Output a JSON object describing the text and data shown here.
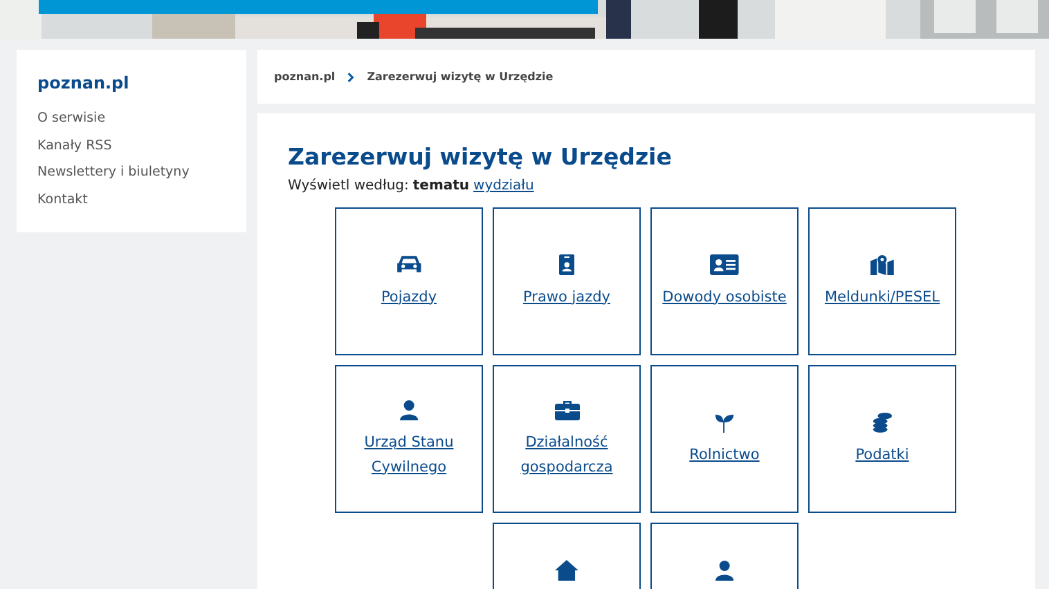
{
  "sidebar": {
    "title": "poznan.pl",
    "items": [
      "O serwisie",
      "Kanały RSS",
      "Newslettery i biuletyny",
      "Kontakt"
    ]
  },
  "breadcrumb": [
    "poznan.pl",
    "Zarezerwuj wizytę w Urzędzie"
  ],
  "heading": "Zarezerwuj wizytę w Urzędzie",
  "filter": {
    "label": "Wyświetl według:",
    "current": "tematu",
    "link": "wydziału"
  },
  "tiles": [
    {
      "kind": "full",
      "label": "Pojazdy"
    },
    {
      "kind": "full",
      "label": "Prawo jazdy"
    },
    {
      "kind": "full",
      "label": "Dowody osobiste"
    },
    {
      "kind": "full",
      "label": "Meldunki/PESEL"
    },
    {
      "kind": "full",
      "label": "Urząd Stanu Cywilnego"
    },
    {
      "kind": "full",
      "label": "Działalność gospodarcza"
    },
    {
      "kind": "full",
      "label": "Rolnictwo"
    },
    {
      "kind": "full",
      "label": "Podatki"
    },
    {
      "kind": "partial"
    },
    {
      "kind": "partial"
    }
  ]
}
